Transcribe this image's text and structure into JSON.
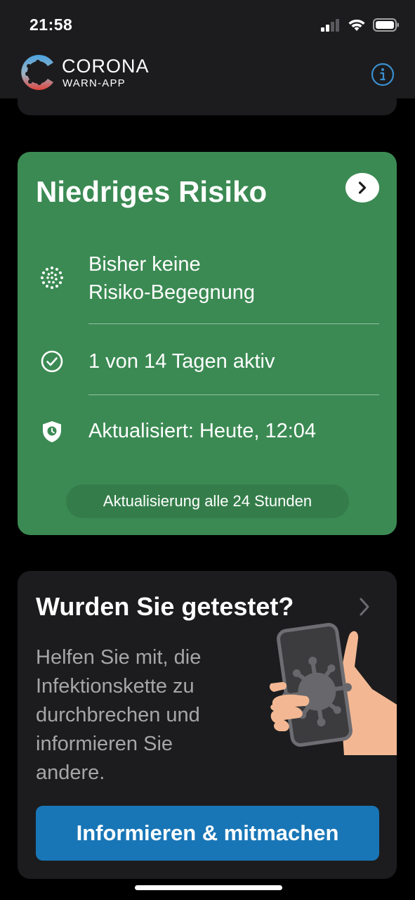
{
  "status_bar": {
    "time": "21:58"
  },
  "header": {
    "brand_title": "CORONA",
    "brand_subtitle": "WARN-APP"
  },
  "risk_card": {
    "title": "Niedriges Risiko",
    "rows": [
      {
        "icon": "exposure-dots-icon",
        "line1": "Bisher keine",
        "line2": "Risiko-Begegnung"
      },
      {
        "icon": "check-circle-icon",
        "line1": "1 von 14 Tagen aktiv"
      },
      {
        "icon": "shield-clock-icon",
        "line1": "Aktualisiert: Heute, 12:04"
      }
    ],
    "update_note": "Aktualisierung alle 24 Stunden",
    "color": "#3b8a53"
  },
  "test_card": {
    "title": "Wurden Sie getestet?",
    "description_lines": [
      "Helfen Sie mit, die",
      "Infektionskette zu",
      "durchbrechen und",
      "informieren Sie",
      "andere."
    ],
    "button_label": "Informieren & mitmachen",
    "button_color": "#1876b7"
  }
}
